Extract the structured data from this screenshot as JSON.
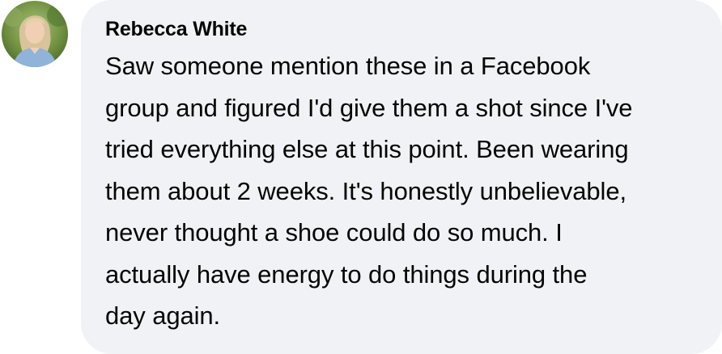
{
  "comment": {
    "avatar_icon": "profile-photo",
    "author": "Rebecca White",
    "lines": [
      "Saw someone mention these in a Facebook",
      "group and figured I'd give them a shot since I've",
      "tried everything else at this point. Been wearing",
      "them about 2 weeks. It's honestly unbelievable,",
      "never thought a shoe could do so much. I",
      "actually have energy to do things during the",
      "day again."
    ]
  },
  "colors": {
    "bubble_background": "#f0f2f5",
    "text": "#050505"
  }
}
